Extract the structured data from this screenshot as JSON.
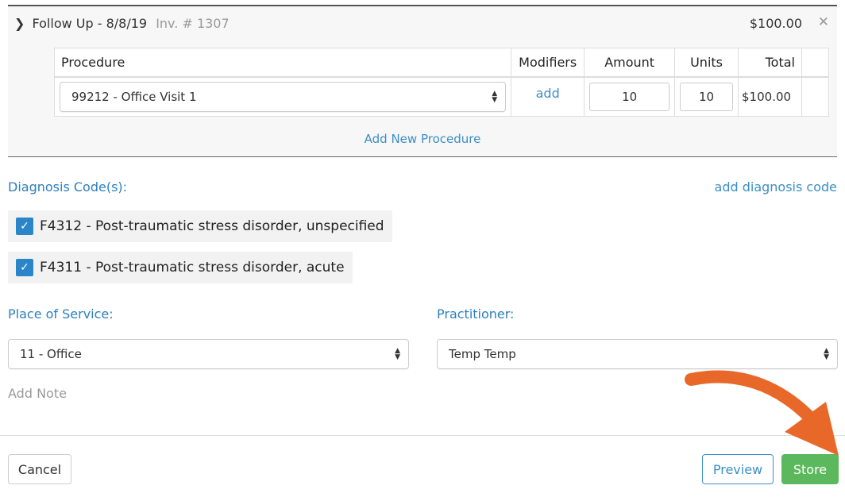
{
  "visit": {
    "title": "Follow Up - 8/8/19",
    "invoice": "Inv. # 1307",
    "total": "$100.00"
  },
  "procedures": {
    "headers": {
      "procedure": "Procedure",
      "modifiers": "Modifiers",
      "amount": "Amount",
      "units": "Units",
      "total": "Total"
    },
    "rows": [
      {
        "procedure": "99212 - Office Visit 1",
        "modifiers_link": "add",
        "amount": "10",
        "units": "10",
        "total": "$100.00"
      }
    ],
    "add_new_label": "Add New Procedure"
  },
  "diagnosis": {
    "label": "Diagnosis Code(s):",
    "add_label": "add diagnosis code",
    "items": [
      {
        "text": "F4312 - Post-traumatic stress disorder, unspecified",
        "checked": true
      },
      {
        "text": "F4311 - Post-traumatic stress disorder, acute",
        "checked": true
      }
    ]
  },
  "place_of_service": {
    "label": "Place of Service:",
    "value": "11 - Office"
  },
  "practitioner": {
    "label": "Practitioner:",
    "value": "Temp Temp"
  },
  "add_note_label": "Add Note",
  "buttons": {
    "cancel": "Cancel",
    "preview": "Preview",
    "store": "Store"
  },
  "icons": {
    "expand": "chevron-right-icon",
    "close": "close-icon",
    "select": "select-arrows-icon",
    "check": "checkmark-icon",
    "annotation": "curved-arrow-icon"
  },
  "colors": {
    "link": "#3a8fc6",
    "primary": "#2a86c8",
    "success": "#5cb85c",
    "annotation": "#e8682a"
  }
}
